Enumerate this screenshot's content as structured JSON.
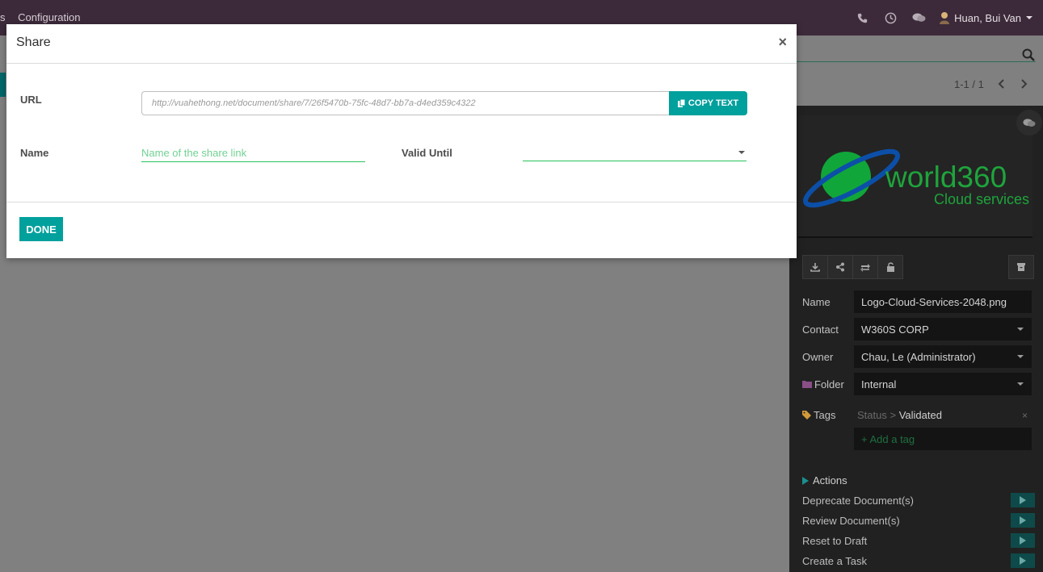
{
  "topbar": {
    "menu_fragment": "s",
    "menu_configuration": "Configuration",
    "user_name": "Huan, Bui Van"
  },
  "pager": {
    "text": "1-1 / 1"
  },
  "inspector": {
    "logo_main": "world360",
    "logo_sub": "Cloud services",
    "fields": {
      "name_label": "Name",
      "name_value": "Logo-Cloud-Services-2048.png",
      "contact_label": "Contact",
      "contact_value": "W360S CORP",
      "owner_label": "Owner",
      "owner_value": "Chau, Le (Administrator)",
      "folder_label": "Folder",
      "folder_value": "Internal",
      "tags_label": "Tags"
    },
    "tag": {
      "category": "Status",
      "separator": ">",
      "value": "Validated",
      "remove": "×"
    },
    "add_tag_placeholder": "+ Add a tag",
    "actions_title": "Actions",
    "actions": [
      {
        "label": "Deprecate Document(s)"
      },
      {
        "label": "Review Document(s)"
      },
      {
        "label": "Reset to Draft"
      },
      {
        "label": "Create a Task"
      }
    ]
  },
  "modal": {
    "title": "Share",
    "close": "×",
    "url_label": "URL",
    "url_value": "http://vuahethong.net/document/share/7/26f5470b-75fc-48d7-bb7a-d4ed359c4322",
    "copy_label": "COPY TEXT",
    "name_label": "Name",
    "name_placeholder": "Name of the share link",
    "valid_until_label": "Valid Until",
    "done_label": "DONE"
  },
  "colors": {
    "accent": "#00a09d",
    "topbar": "#3c2a3a",
    "field_underline": "#2bc25a"
  }
}
